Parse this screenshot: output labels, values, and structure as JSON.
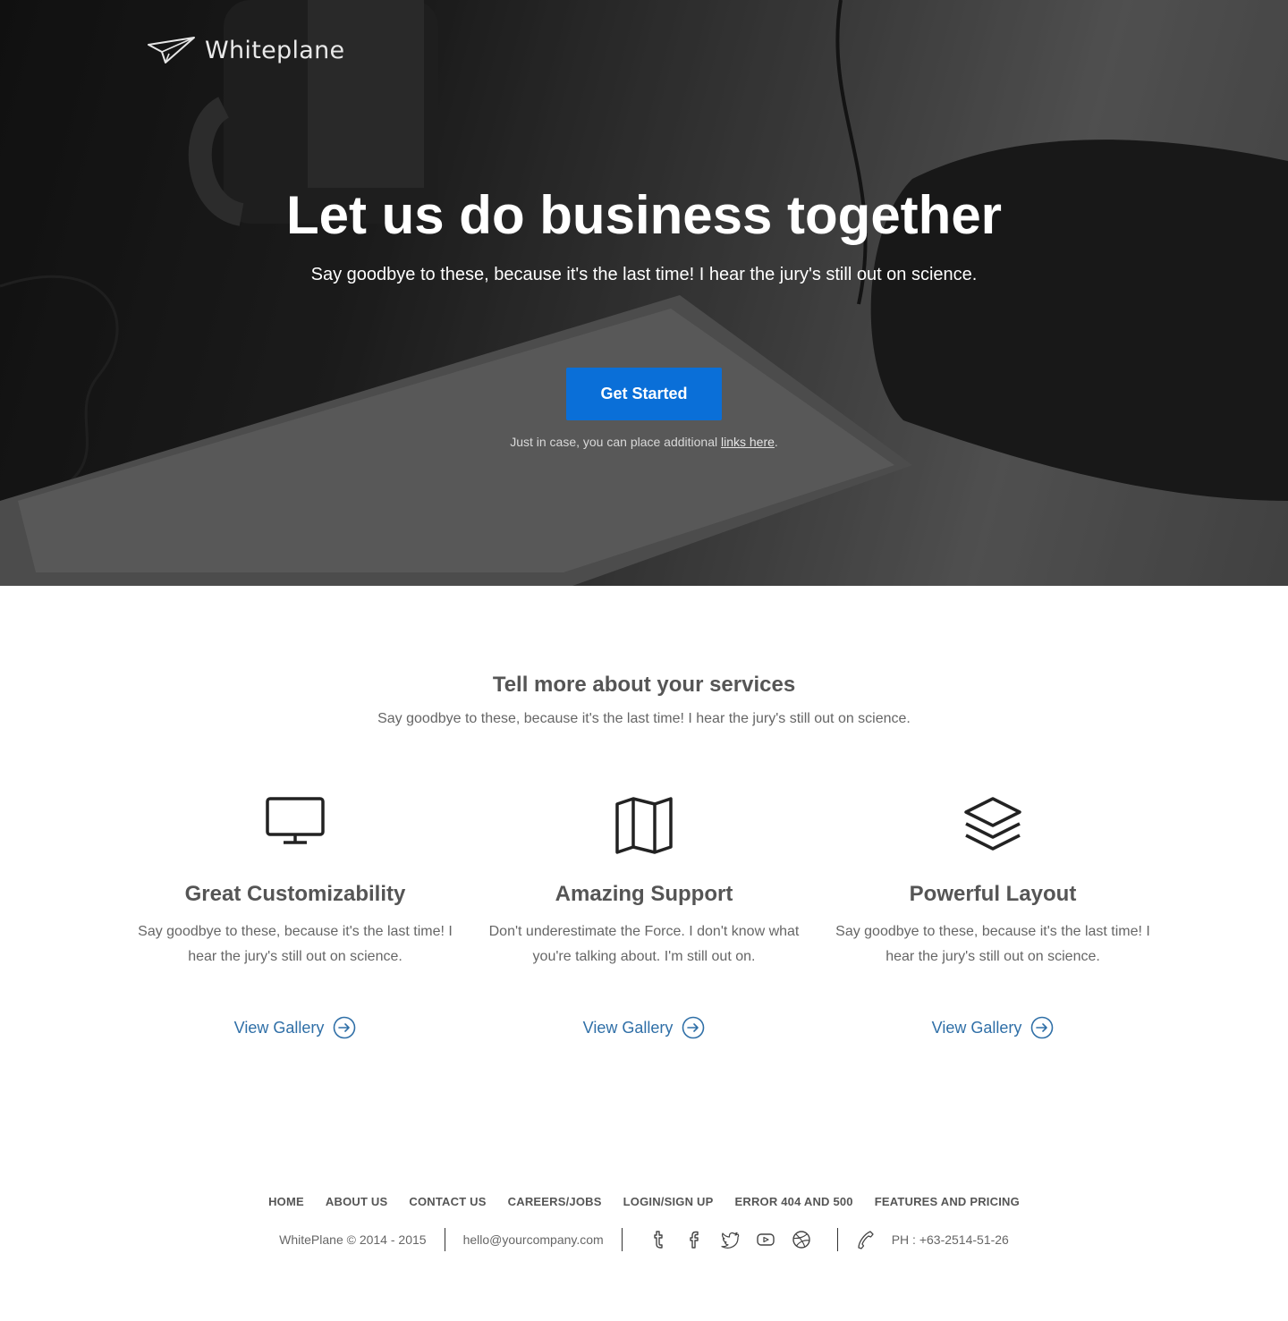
{
  "brand": {
    "name": "Whiteplane"
  },
  "hero": {
    "title": "Let us do business together",
    "subtitle": "Say goodbye to these, because it's the last time! I hear the jury's still out on science.",
    "cta_label": "Get Started",
    "note_prefix": "Just in case, you can place additional ",
    "note_link": "links here",
    "note_suffix": "."
  },
  "services": {
    "title": "Tell more about your services",
    "subtitle": "Say goodbye to these, because it's the last time! I hear the jury's still out on science.",
    "features": [
      {
        "icon": "monitor-icon",
        "title": "Great Customizability",
        "text": "Say goodbye to these, because it's the last time! I hear the jury's still out on science.",
        "link": "View Gallery"
      },
      {
        "icon": "map-icon",
        "title": "Amazing Support",
        "text": "Don't underestimate the Force. I don't know what you're talking about. I'm still out on.",
        "link": "View Gallery"
      },
      {
        "icon": "layers-icon",
        "title": "Powerful Layout",
        "text": "Say goodbye to these, because it's the last time! I hear the jury's still out on science.",
        "link": "View Gallery"
      }
    ]
  },
  "footer": {
    "nav": [
      "HOME",
      "ABOUT US",
      "CONTACT US",
      "CAREERS/JOBS",
      "LOGIN/SIGN UP",
      "ERROR 404 AND 500",
      "FEATURES AND PRICING"
    ],
    "copyright": "WhitePlane © 2014 - 2015",
    "email": "hello@yourcompany.com",
    "social": [
      "tumblr-icon",
      "facebook-icon",
      "twitter-icon",
      "youtube-icon",
      "dribbble-icon"
    ],
    "phone": "PH : +63-2514-51-26"
  },
  "colors": {
    "primary": "#0a6fd8",
    "link": "#2f6fa7",
    "text": "#555555"
  }
}
